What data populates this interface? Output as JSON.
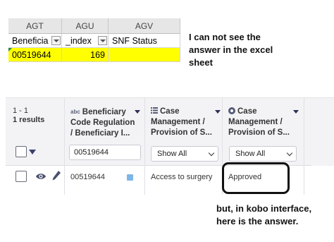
{
  "excel": {
    "columns": [
      "AGT",
      "AGU",
      "AGV"
    ],
    "header_row": [
      "Beneficia",
      "_index",
      "SNF Status"
    ],
    "data_row": [
      "00519644",
      "169",
      ""
    ],
    "highlight_color": "#ffff00"
  },
  "note_excel": "I can not see the answer in the excel sheet",
  "kobo": {
    "results_count": "1 - 1",
    "results_label": "1 results",
    "columns": [
      {
        "type_label": "abc",
        "title": "Beneficiary Code Regulation / Beneficiary I...",
        "filter_value": "00519644"
      },
      {
        "icon": "list-icon",
        "title": "Case Management / Provision of S...",
        "filter_value": "Show All"
      },
      {
        "icon": "radio-icon",
        "title": "Case Management / Provision of S...",
        "filter_value": "Show All"
      }
    ],
    "row": {
      "beneficiary_code": "00519644",
      "service": "Access to surgery",
      "status": "Approved"
    }
  },
  "note_kobo": "but, in kobo interface, here is the answer.",
  "colors": {
    "header_bg": "#f3f3f6",
    "accent": "#3a3f6b",
    "link": "#7eb6e6"
  }
}
